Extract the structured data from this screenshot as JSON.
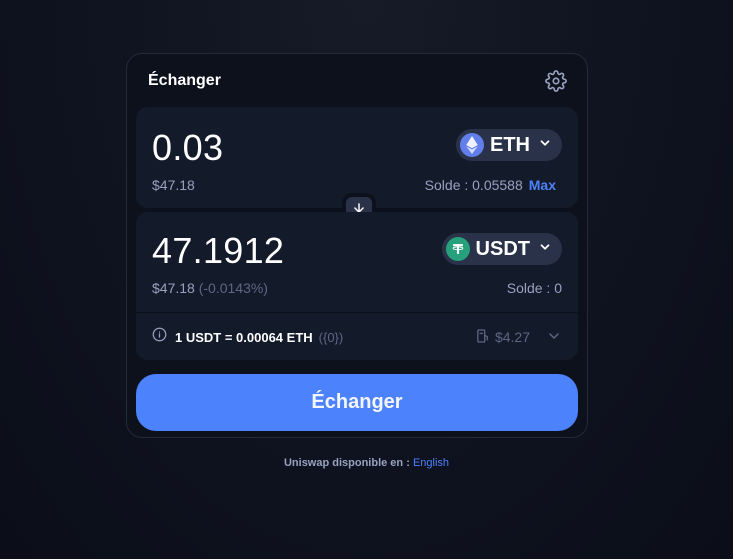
{
  "header": {
    "title": "Échanger"
  },
  "input": {
    "amount": "0.03",
    "usd_value": "$47.18",
    "token_symbol": "ETH",
    "balance_label": "Solde : 0.05588",
    "max_label": "Max"
  },
  "output": {
    "amount": "47.1912",
    "usd_value": "$47.18",
    "price_impact": "(-0.0143%)",
    "token_symbol": "USDT",
    "balance_label": "Solde : 0"
  },
  "rate": {
    "text": "1 USDT = 0.00064 ETH",
    "usd": "({0})",
    "gas_fee": "$4.27"
  },
  "swap_button": {
    "label": "Échanger"
  },
  "footer": {
    "text": "Uniswap disponible en :",
    "language": "English"
  },
  "colors": {
    "accent": "#4c82fb",
    "background": "#0d111c",
    "panel": "#131a2a"
  },
  "icons": [
    "gear-icon",
    "eth-icon",
    "usdt-icon",
    "chevron-down-icon",
    "arrow-down-icon",
    "info-icon",
    "gas-pump-icon"
  ]
}
